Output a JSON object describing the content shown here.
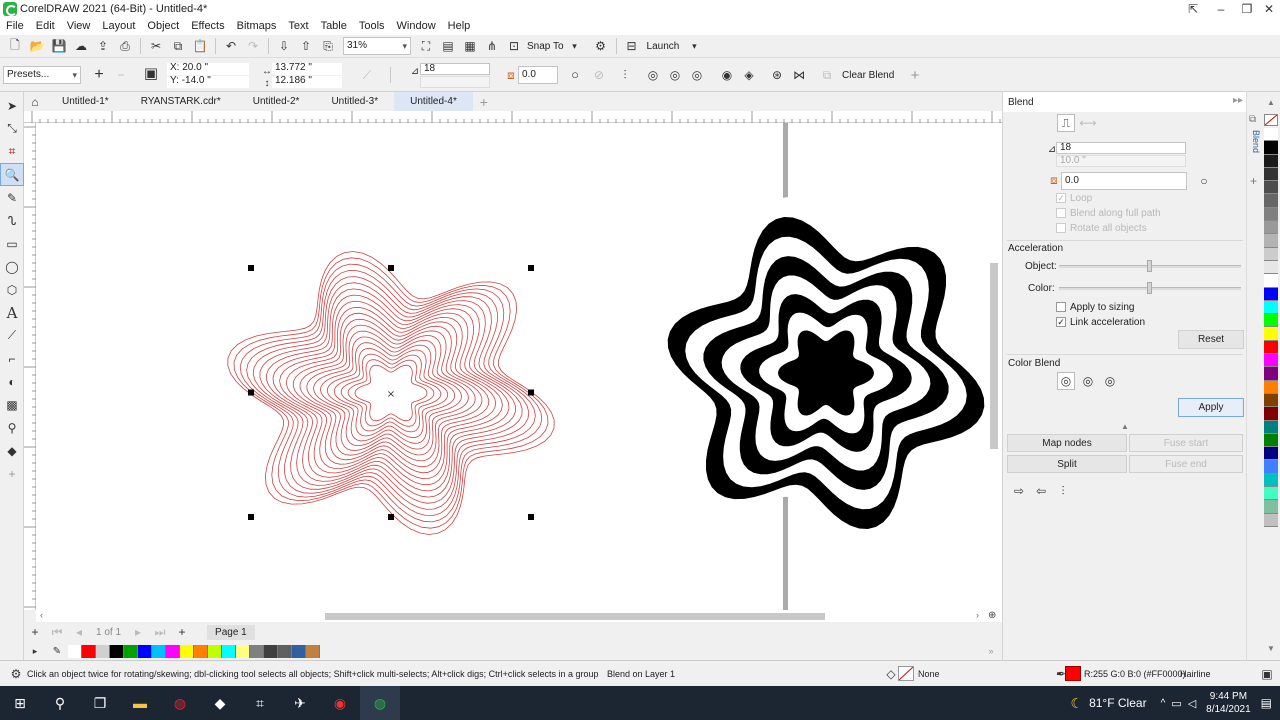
{
  "window": {
    "title": "CorelDRAW 2021 (64-Bit) - Untitled-4*"
  },
  "menu": [
    "File",
    "Edit",
    "View",
    "Layout",
    "Object",
    "Effects",
    "Bitmaps",
    "Text",
    "Table",
    "Tools",
    "Window",
    "Help"
  ],
  "standard_toolbar": {
    "zoom": "31%",
    "snap_to": "Snap To",
    "launch": "Launch"
  },
  "property_bar": {
    "presets": "Presets...",
    "pos_x": "X: 20.0 \"",
    "pos_y": "Y: -14.0 \"",
    "width": "13.772 \"",
    "height": "12.186 \"",
    "blend_steps": "18",
    "blend_direction": "0.0",
    "clear_blend": "Clear Blend"
  },
  "tabs": [
    "Untitled-1*",
    "RYANSTARK.cdr*",
    "Untitled-2*",
    "Untitled-3*",
    "Untitled-4*"
  ],
  "active_tab": 4,
  "page_nav": {
    "counter": "1 of 1",
    "page": "Page 1"
  },
  "docker": {
    "title": "Blend",
    "steps": "18",
    "spacing": "10.0 \"",
    "direction": "0.0",
    "loop": "Loop",
    "blend_full_path": "Blend along full path",
    "rotate_all": "Rotate all objects",
    "acceleration": "Acceleration",
    "object": "Object:",
    "color": "Color:",
    "apply_sizing": "Apply to sizing",
    "link_accel": "Link acceleration",
    "reset": "Reset",
    "color_blend": "Color Blend",
    "apply": "Apply",
    "map_nodes": "Map nodes",
    "fuse_start": "Fuse start",
    "split": "Split",
    "fuse_end": "Fuse end",
    "side_tab": "Blend"
  },
  "status": {
    "hint": "Click an object twice for rotating/skewing; dbl-clicking tool selects all objects; Shift+click multi-selects; Alt+click digs; Ctrl+click selects in a group",
    "layer": "Blend on Layer 1",
    "fill": "None",
    "outline_color": "R:255 G:0 B:0 (#FF0000)",
    "outline_width": "Hairline"
  },
  "taskbar": {
    "weather": "81°F  Clear",
    "time": "9:44 PM",
    "date": "8/14/2021"
  },
  "colors": {
    "blend_red": "#d04040",
    "active_tab": "#dce6f5",
    "taskbar": "#1c2532"
  },
  "palette_bottom": [
    "#ffffff",
    "#ff0000",
    "#d0d0d0",
    "#000000",
    "#00a000",
    "#0000ff",
    "#00c0ff",
    "#ff00ff",
    "#ffff00",
    "#ff8000",
    "#c0ff00",
    "#00ffff",
    "#ffff80",
    "#808080",
    "#404040",
    "#606060",
    "#3060a0",
    "#c08040"
  ],
  "palette_right": [
    "#ffffff",
    "#000000",
    "#1a1a1a",
    "#333333",
    "#4d4d4d",
    "#666666",
    "#808080",
    "#999999",
    "#b3b3b3",
    "#cccccc",
    "#e6e6e6",
    "#ffffff",
    "#0000ff",
    "#00ffff",
    "#00ff00",
    "#ffff00",
    "#ff0000",
    "#ff00ff",
    "#800080",
    "#ff8000",
    "#804000",
    "#800000",
    "#008080",
    "#008000",
    "#000080",
    "#4080ff",
    "#00c0c0",
    "#40ffc0",
    "#80c0a0",
    "#c0c0c0"
  ]
}
